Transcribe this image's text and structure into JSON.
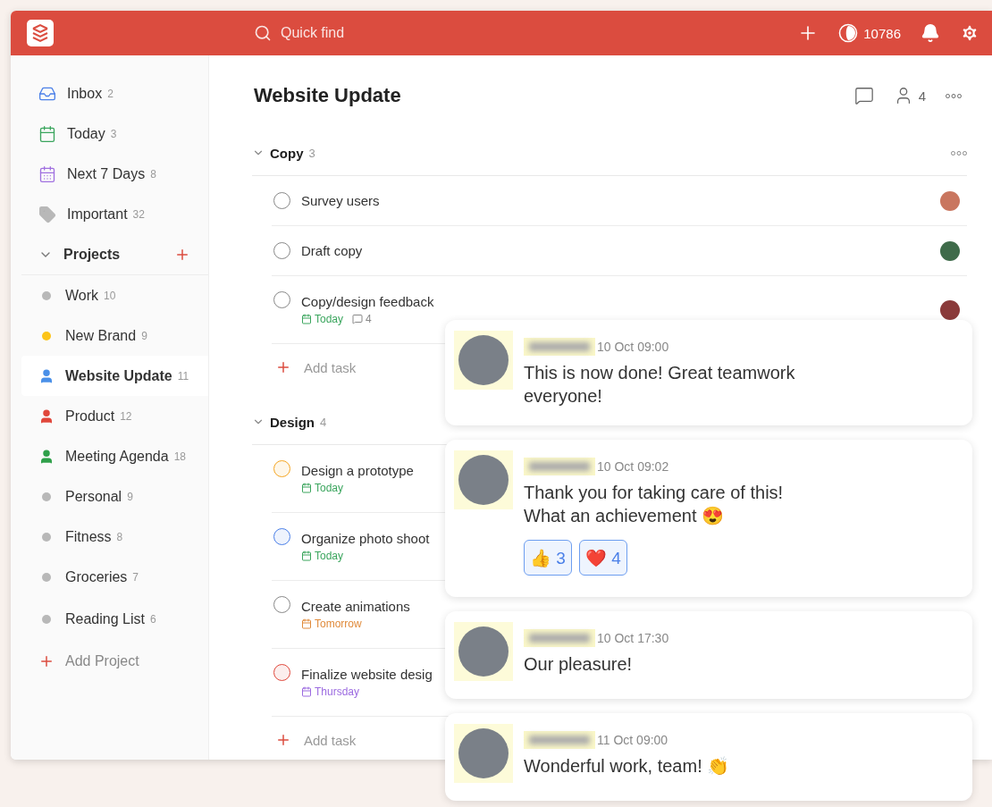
{
  "topbar": {
    "search": {
      "placeholder": "Quick find"
    },
    "karma": "10786"
  },
  "sidebar": {
    "filters": [
      {
        "kind": "inbox",
        "label": "Inbox",
        "count": "2",
        "color": "#4a7fe8"
      },
      {
        "kind": "today",
        "label": "Today",
        "count": "3",
        "color": "#3aa55d"
      },
      {
        "kind": "upcoming",
        "label": "Next 7 Days",
        "count": "8",
        "color": "#a070e0"
      },
      {
        "kind": "label",
        "label": "Important",
        "count": "32",
        "color": "#b8b8b8"
      }
    ],
    "projects_title": "Projects",
    "projects_expanded": true,
    "projects": [
      {
        "kind": "dot",
        "label": "Work",
        "count": "10",
        "color": "#b8b8b8",
        "selected": false
      },
      {
        "kind": "dot",
        "label": "New Brand",
        "count": "9",
        "color": "#fcc419",
        "selected": false
      },
      {
        "kind": "shared",
        "label": "Website Update",
        "count": "11",
        "color": "#4a90e8",
        "selected": true
      },
      {
        "kind": "shared",
        "label": "Product",
        "count": "12",
        "color": "#e0473b",
        "selected": false
      },
      {
        "kind": "shared",
        "label": "Meeting Agenda",
        "count": "18",
        "color": "#2fa04a",
        "selected": false
      },
      {
        "kind": "dot",
        "label": "Personal",
        "count": "9",
        "color": "#b8b8b8",
        "selected": false
      },
      {
        "kind": "dot",
        "label": "Fitness",
        "count": "8",
        "color": "#b8b8b8",
        "selected": false
      },
      {
        "kind": "dot",
        "label": "Groceries",
        "count": "7",
        "color": "#b8b8b8",
        "selected": false
      },
      {
        "kind": "dot",
        "label": "Reading List",
        "count": "6",
        "color": "#b8b8b8",
        "selected": false
      }
    ],
    "add_project": "Add Project"
  },
  "project": {
    "title": "Website Update",
    "members": "4"
  },
  "sections": [
    {
      "title": "Copy",
      "count": "3",
      "expanded": true,
      "add_task": "Add task",
      "tasks": [
        {
          "title": "Survey users",
          "color": "#888888",
          "assigned": true
        },
        {
          "title": "Draft copy",
          "color": "#888888",
          "assigned": true
        },
        {
          "title": "Copy/design feedback",
          "color": "#888888",
          "assigned": true,
          "due": {
            "label": "Today",
            "color": "#3aa55d"
          },
          "comments": "4"
        }
      ]
    },
    {
      "title": "Design",
      "count": "4",
      "expanded": true,
      "add_task": "Add task",
      "tasks": [
        {
          "title": "Design a prototype",
          "color": "#f5a623",
          "due": {
            "label": "Today",
            "color": "#3aa55d"
          }
        },
        {
          "title": "Organize photo shoot",
          "color": "#4a7fe8",
          "due": {
            "label": "Today",
            "color": "#3aa55d"
          }
        },
        {
          "title": "Create animations",
          "color": "#888888",
          "due": {
            "label": "Tomorrow",
            "color": "#e08a3a"
          }
        },
        {
          "title": "Finalize website desig",
          "color": "#e0473b",
          "due": {
            "label": "Thursday",
            "color": "#9b6ae0"
          }
        }
      ]
    }
  ],
  "comments": [
    {
      "time": "10 Oct 09:00",
      "text": "This is now done! Great teamwork everyone!"
    },
    {
      "time": "10 Oct 09:02",
      "text": "Thank you for taking care of this!\nWhat an achievement 😍",
      "reactions": [
        {
          "emoji": "👍",
          "count": "3"
        },
        {
          "emoji": "❤️",
          "count": "4"
        }
      ]
    },
    {
      "time": "10 Oct 17:30",
      "text": "Our pleasure!"
    },
    {
      "time": "11 Oct 09:00",
      "text": "Wonderful work, team! 👏"
    }
  ]
}
